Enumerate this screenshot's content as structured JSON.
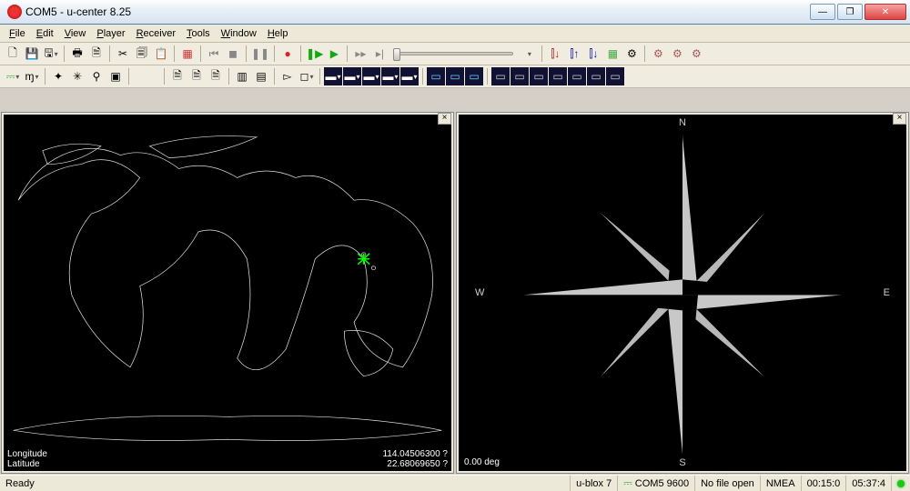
{
  "window": {
    "title": "COM5 - u-center 8.25"
  },
  "menu": {
    "file": "File",
    "edit": "Edit",
    "view": "View",
    "player": "Player",
    "receiver": "Receiver",
    "tools": "Tools",
    "window": "Window",
    "help": "Help"
  },
  "map": {
    "lonLabel": "Longitude",
    "latLabel": "Latitude",
    "lonVal": "114.04506300 ?",
    "latVal": "22.68069650 ?"
  },
  "compass": {
    "n": "N",
    "e": "E",
    "s": "S",
    "w": "W",
    "deg": "0.00 deg"
  },
  "status": {
    "ready": "Ready",
    "device": "u-blox 7",
    "port": "COM5 9600",
    "file": "No file open",
    "proto": "NMEA",
    "t1": "00:15:0",
    "t2": "05:37:4"
  }
}
